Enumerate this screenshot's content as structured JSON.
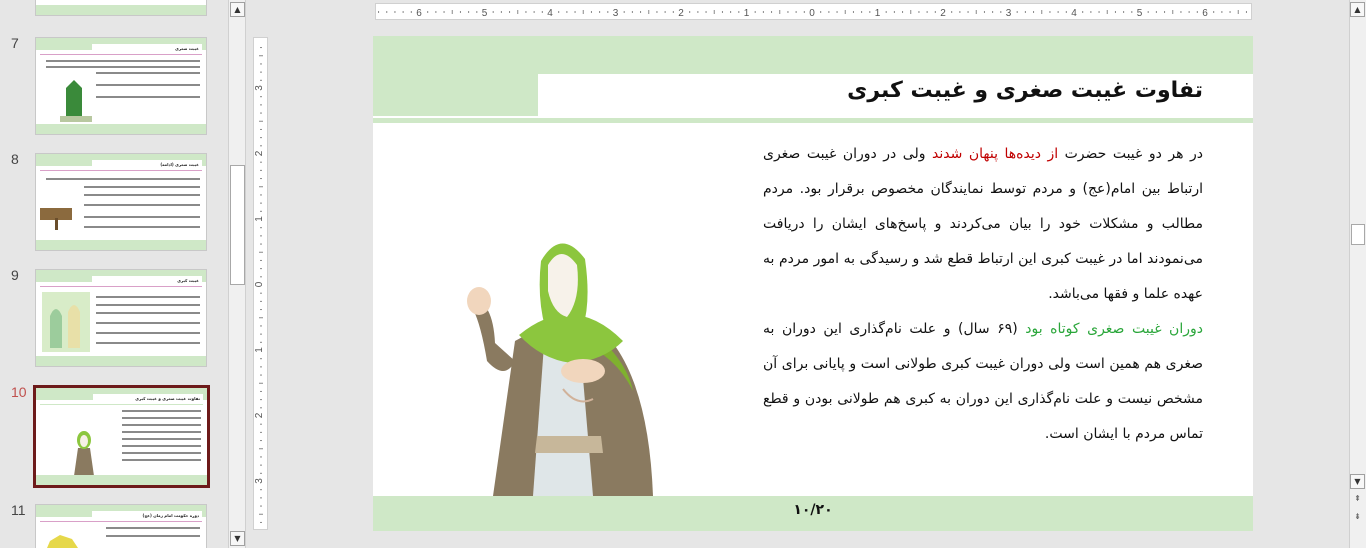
{
  "thumbnails": [
    {
      "number": "7",
      "title": "غیبت صغری"
    },
    {
      "number": "8",
      "title": "غیبت صغری (ادامه)"
    },
    {
      "number": "9",
      "title": "غیبت کبری"
    },
    {
      "number": "10",
      "title": "تفاوت غیبت صغری و غیبت کبری"
    },
    {
      "number": "11",
      "title": "دوره حکومت امام زمان (عج)"
    }
  ],
  "ruler": {
    "h_labels": [
      "6",
      "5",
      "4",
      "3",
      "2",
      "1",
      "0",
      "1",
      "2",
      "3",
      "4",
      "5",
      "6"
    ],
    "v_labels": [
      "3",
      "2",
      "1",
      "0",
      "1",
      "2",
      "3"
    ]
  },
  "slide": {
    "title": "تفاوت غیبت صغری و غیبت کبری",
    "p1_a": "در هر دو غیبت حضرت ",
    "p1_red": "از دیده‌ها پنهان شدند",
    "p1_b": " ولی در دوران غیبت صغری ارتباط بین امام(عج) و مردم توسط نمایندگان مخصوص برقرار بود. مردم مطالب و مشکلات خود را بیان می‌کردند و پاسخ‌های ایشان را دریافت می‌نمودند اما در غیبت کبری این ارتباط قطع شد و رسیدگی به امور مردم به عهده علما و فقها می‌باشد.",
    "p2_green": "دوران غیبت صغری کوتاه بود",
    "p2_b": " (۶۹ سال) و علت نام‌گذاری این دوران به صغری هم همین است ولی دوران غیبت کبری طولانی است و پایانی برای آن مشخص نیست و علت نام‌گذاری این دوران به کبری هم طولانی بودن و قطع تماس مردم با ایشان است.",
    "page_number": "۱۰/۲۰"
  },
  "colors": {
    "band": "#cfe8c7",
    "selected_border": "#6d1a1a",
    "red_text": "#c00000",
    "green_text": "#2aa63a"
  }
}
